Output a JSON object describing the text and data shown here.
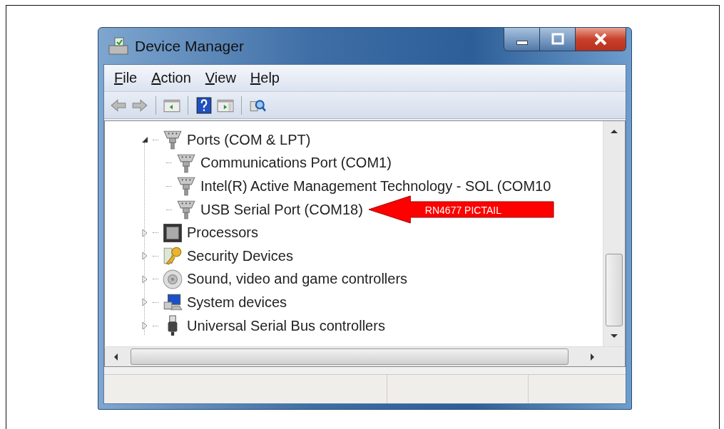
{
  "window": {
    "title": "Device Manager"
  },
  "menu": [
    {
      "label": "File"
    },
    {
      "label": "Action"
    },
    {
      "label": "View"
    },
    {
      "label": "Help"
    }
  ],
  "toolbar": [
    {
      "kind": "back"
    },
    {
      "kind": "forward"
    },
    {
      "kind": "separator"
    },
    {
      "kind": "tree"
    },
    {
      "kind": "separator"
    },
    {
      "kind": "help"
    },
    {
      "kind": "pane"
    },
    {
      "kind": "separator"
    },
    {
      "kind": "scan"
    }
  ],
  "tree": [
    {
      "label": "Ports (COM & LPT)",
      "kind": "port",
      "expanded": true,
      "children": [
        {
          "label": "Communications Port (COM1)",
          "kind": "port"
        },
        {
          "label": "Intel(R) Active Management Technology - SOL (COM10",
          "kind": "port"
        },
        {
          "label": "USB Serial Port (COM18)",
          "kind": "port",
          "callout": "RN4677 PICTAIL"
        }
      ]
    },
    {
      "label": "Processors",
      "kind": "chip",
      "expanded": false
    },
    {
      "label": "Security Devices",
      "kind": "key",
      "expanded": false
    },
    {
      "label": "Sound, video and game controllers",
      "kind": "speaker",
      "expanded": false
    },
    {
      "label": "System devices",
      "kind": "computer",
      "expanded": false
    },
    {
      "label": "Universal Serial Bus controllers",
      "kind": "usb",
      "expanded": false
    }
  ]
}
